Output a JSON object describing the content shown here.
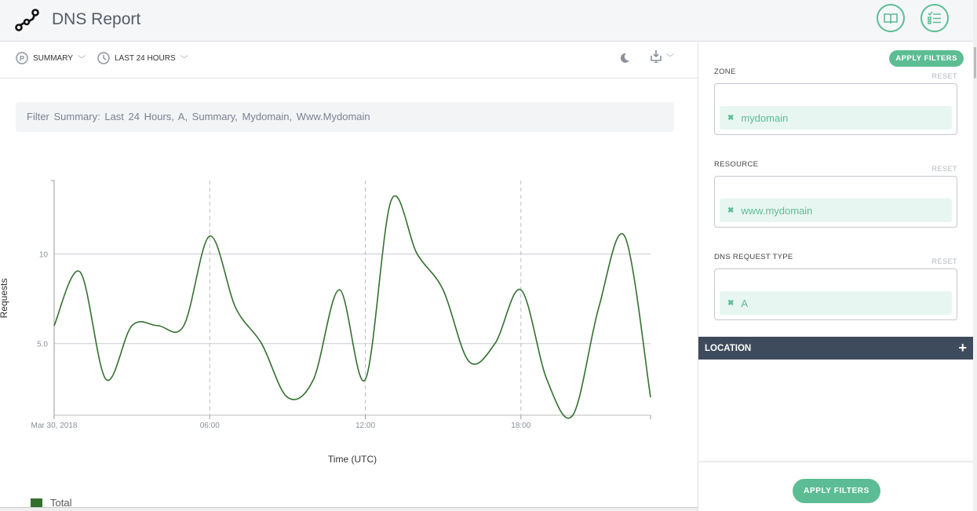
{
  "header": {
    "title": "DNS Report",
    "icons": [
      "logo-nodes-icon",
      "book-icon",
      "checklist-icon"
    ]
  },
  "toolbar": {
    "summary_label": "SUMMARY",
    "time_label": "LAST 24 HOURS",
    "icons": [
      "summary-p-icon",
      "clock-icon",
      "moon-icon",
      "download-icon"
    ]
  },
  "filter_summary": "Filter Summary:  Last 24 Hours,  A,  Summary,  Mydomain,  Www.Mydomain",
  "sidebar": {
    "apply_top": "APPLY FILTERS",
    "filters": [
      {
        "label": "ZONE",
        "reset": "RESET",
        "value": "mydomain"
      },
      {
        "label": "RESOURCE",
        "reset": "RESET",
        "value": "www.mydomain"
      },
      {
        "label": "DNS REQUEST TYPE",
        "reset": "RESET",
        "value": "A"
      }
    ],
    "location": "LOCATION",
    "location_icon": "+",
    "apply_bottom": "APPLY FILTERS",
    "accent": "#5cbd95"
  },
  "chart_data": {
    "type": "line",
    "xlabel": "Time (UTC)",
    "ylabel": "Requests",
    "x": [
      "00:00",
      "01:00",
      "02:00",
      "03:00",
      "04:00",
      "05:00",
      "06:00",
      "07:00",
      "08:00",
      "09:00",
      "10:00",
      "11:00",
      "12:00",
      "13:00",
      "14:00",
      "15:00",
      "16:00",
      "17:00",
      "18:00",
      "19:00",
      "20:00",
      "21:00",
      "22:00",
      "23:00"
    ],
    "xticks": [
      {
        "hour": 0,
        "label": "Mar 30, 2018"
      },
      {
        "hour": 6,
        "label": "06:00"
      },
      {
        "hour": 12,
        "label": "12:00"
      },
      {
        "hour": 18,
        "label": "18:00"
      }
    ],
    "yticks": [
      {
        "value": 5,
        "label": "5.0"
      },
      {
        "value": 10,
        "label": "10"
      }
    ],
    "ylim": [
      1,
      14.1
    ],
    "xlim": [
      0,
      23
    ],
    "series": [
      {
        "name": "Total",
        "color": "#33702f",
        "values": [
          6,
          9,
          3,
          6,
          6,
          6,
          11,
          7,
          5,
          2,
          3,
          8,
          3,
          13,
          10,
          8,
          4,
          5,
          8,
          3,
          1,
          7,
          11,
          2
        ]
      }
    ],
    "grid": true,
    "legend": "bottom-left"
  }
}
